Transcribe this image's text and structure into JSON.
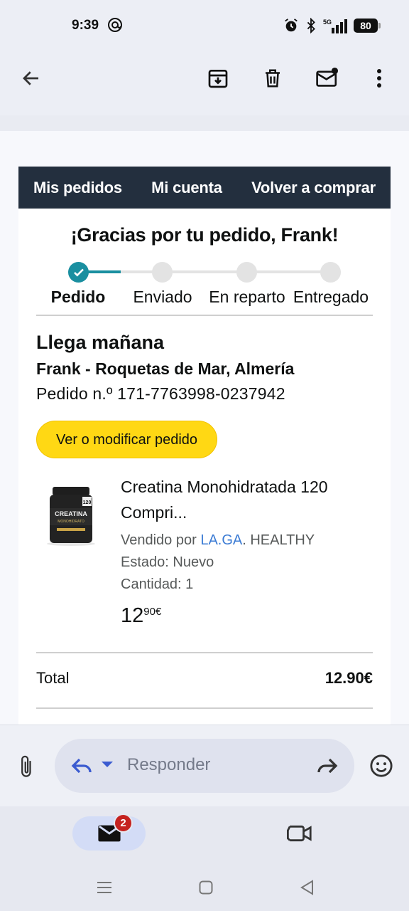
{
  "status_bar": {
    "time": "9:39",
    "network": "5G",
    "battery": "80"
  },
  "toolbar": {
    "back_icon": "arrow-back-icon",
    "archive_icon": "archive-icon",
    "delete_icon": "trash-icon",
    "mark_unread_icon": "mail-unread-icon",
    "more_icon": "more-vert-icon"
  },
  "email": {
    "nav": {
      "items": [
        "Mis pedidos",
        "Mi cuenta",
        "Volver a comprar"
      ]
    },
    "greeting": "¡Gracias por tu pedido, Frank!",
    "tracker": {
      "steps": [
        "Pedido",
        "Enviado",
        "En reparto",
        "Entregado"
      ],
      "current_step": 1,
      "accent_color": "#1a8fa0"
    },
    "arrival": {
      "title": "Llega mañana",
      "address": "Frank - Roquetas de Mar, Almería",
      "order_number": "Pedido n.º 171-7763998-0237942"
    },
    "action_button": {
      "label": "Ver o modificar pedido",
      "color": "#ffd814"
    },
    "product": {
      "title": "Creatina Monohidratada 120 Compri...",
      "seller_prefix": "Vendido por ",
      "seller_link": "LA.GA",
      "seller_suffix": ". HEALTHY",
      "condition": "Estado: Nuevo",
      "quantity": "Cantidad: 1",
      "price_whole": "12",
      "price_fraction": "90€",
      "image_label": "CREATINA MONOHIDRATO"
    },
    "total": {
      "label": "Total",
      "value": "12.90€"
    }
  },
  "reply_bar": {
    "placeholder": "Responder"
  },
  "bottom_nav": {
    "mail_badge": "2"
  }
}
